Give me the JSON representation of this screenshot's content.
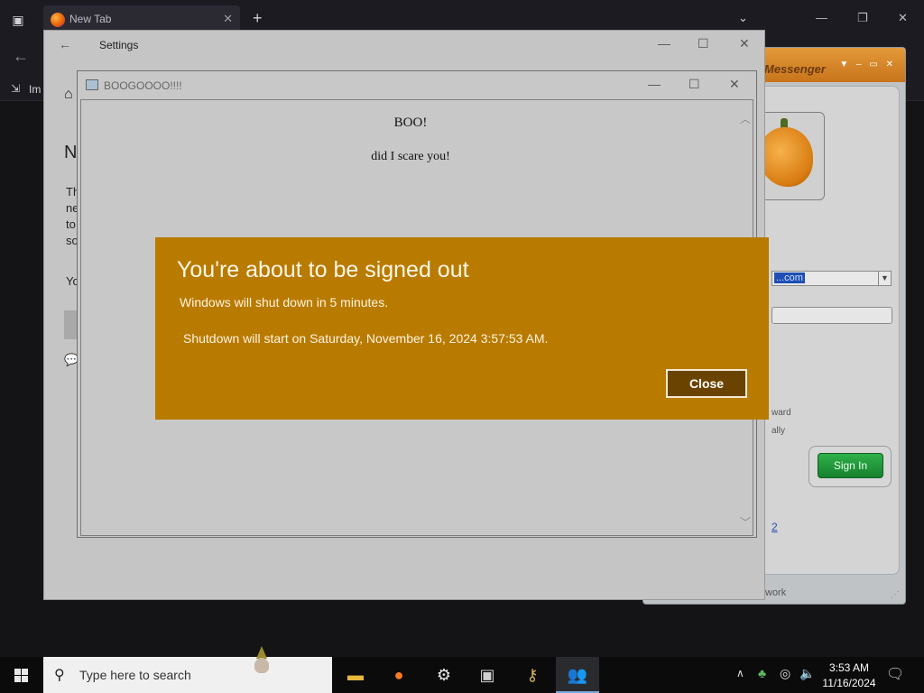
{
  "browser": {
    "tab_title": "New Tab",
    "tab_close": "✕",
    "new_tab": "+",
    "bookmark_label": "Im",
    "bookmark_icon": "⇲"
  },
  "settings": {
    "title": "Settings",
    "heading": "N",
    "para_lines": [
      "Th",
      "ne",
      "to",
      "so"
    ],
    "line2": "Yo"
  },
  "boo_window": {
    "title": "BOOGOOOO!!!!",
    "heading": "BOO!",
    "text": "did I scare you!"
  },
  "messenger": {
    "title": "Messenger",
    "email_fragment": "...com",
    "option1": "ward",
    "option2": "ally",
    "signin_label": "Sign In",
    "link_fragment": "2",
    "status_fragment": "work"
  },
  "notice": {
    "title": "You're about to be signed out",
    "line1": "Windows will shut down in 5 minutes.",
    "line2": "Shutdown will start on Saturday, November 16, 2024 3:57:53 AM.",
    "close_label": "Close"
  },
  "taskbar": {
    "search_placeholder": "Type here to search",
    "time": "3:53 AM",
    "date": "11/16/2024",
    "apps": [
      {
        "name": "file-explorer",
        "icon": "folder-icon"
      },
      {
        "name": "firefox",
        "icon": "firefox-icon"
      },
      {
        "name": "settings",
        "icon": "gear-icon"
      },
      {
        "name": "window-app",
        "icon": "window-icon"
      },
      {
        "name": "keys-app",
        "icon": "keys-icon"
      },
      {
        "name": "messenger",
        "icon": "messenger-icon"
      }
    ]
  },
  "colors": {
    "notice_bg": "#b97a00",
    "notice_button_bg": "#6b4300",
    "messenger_orange": "#e39a3a",
    "signin_green": "#16812d"
  }
}
